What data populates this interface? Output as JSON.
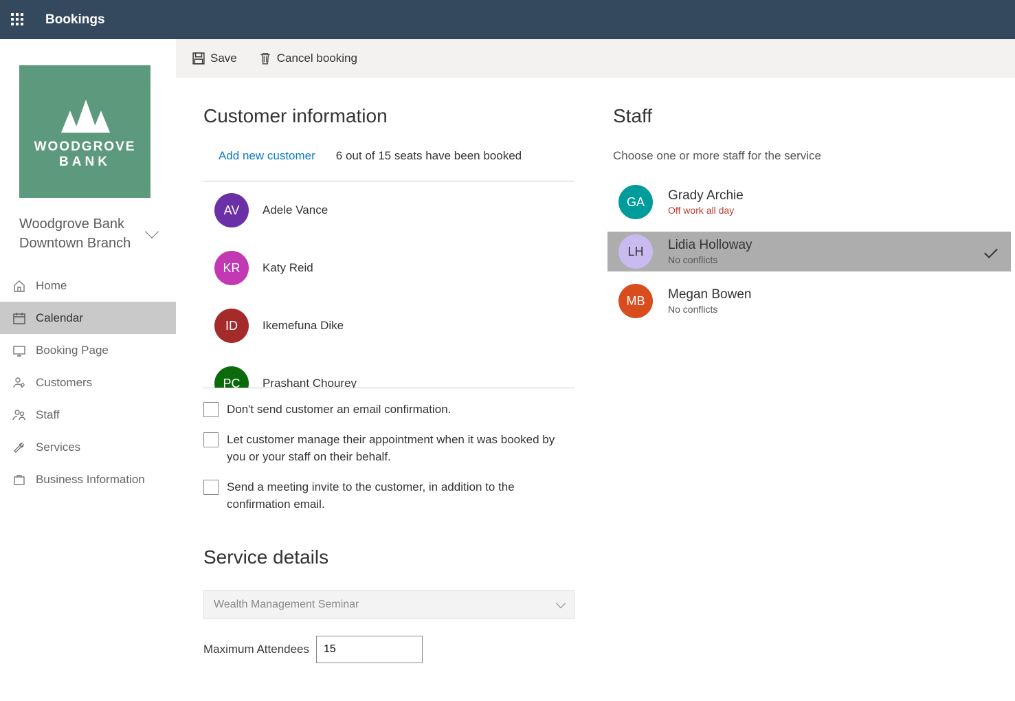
{
  "app": {
    "title": "Bookings"
  },
  "business": {
    "line1": "Woodgrove Bank",
    "line2": "Downtown Branch",
    "logo_line1": "WOODGROVE",
    "logo_line2": "BANK"
  },
  "nav": [
    {
      "id": "home",
      "label": "Home"
    },
    {
      "id": "calendar",
      "label": "Calendar",
      "active": true
    },
    {
      "id": "booking-page",
      "label": "Booking Page"
    },
    {
      "id": "customers",
      "label": "Customers"
    },
    {
      "id": "staff",
      "label": "Staff"
    },
    {
      "id": "services",
      "label": "Services"
    },
    {
      "id": "business-information",
      "label": "Business Information"
    }
  ],
  "toolbar": {
    "save": "Save",
    "cancel": "Cancel booking"
  },
  "customer_section": {
    "heading": "Customer information",
    "add_link": "Add new customer",
    "seats_text": "6 out of 15 seats have been booked",
    "customers": [
      {
        "initials": "AV",
        "name": "Adele Vance",
        "color": "#6b2fa8"
      },
      {
        "initials": "KR",
        "name": "Katy Reid",
        "color": "#c239b3"
      },
      {
        "initials": "ID",
        "name": "Ikemefuna Dike",
        "color": "#a52a2a"
      },
      {
        "initials": "PC",
        "name": "Prashant Chourey",
        "color": "#0b6a0b"
      }
    ],
    "opts": {
      "no_confirm": "Don't send customer an email confirmation.",
      "manage": "Let customer manage their appointment when it was booked by you or your staff on their behalf.",
      "invite": "Send a meeting invite to the customer, in addition to the confirmation email."
    }
  },
  "service_section": {
    "heading": "Service details",
    "service_selected": "Wealth Management Seminar",
    "max_label": "Maximum Attendees",
    "max_value": "15"
  },
  "staff_section": {
    "heading": "Staff",
    "hint": "Choose one or more staff for the service",
    "staff": [
      {
        "initials": "GA",
        "name": "Grady Archie",
        "status": "Off work all day",
        "off": true,
        "color": "#009b9b",
        "selected": false
      },
      {
        "initials": "LH",
        "name": "Lidia Holloway",
        "status": "No conflicts",
        "off": false,
        "color": "#c9baf0",
        "textcolor": "#333",
        "selected": true
      },
      {
        "initials": "MB",
        "name": "Megan Bowen",
        "status": "No conflicts",
        "off": false,
        "color": "#d84c1d",
        "selected": false
      }
    ]
  }
}
